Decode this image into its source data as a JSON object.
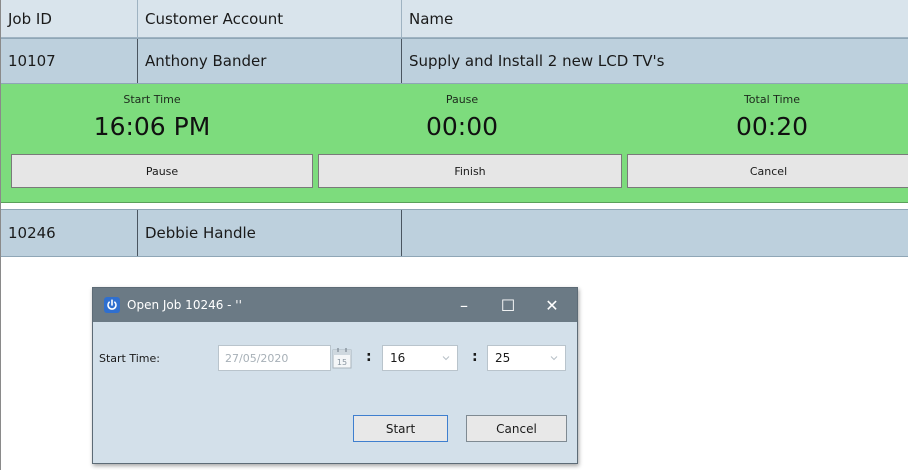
{
  "table": {
    "headers": [
      "Job ID",
      "Customer Account",
      "Name"
    ],
    "rows": [
      {
        "job_id": "10107",
        "customer": "Anthony Bander",
        "name": "Supply and Install 2 new LCD TV's"
      },
      {
        "job_id": "10246",
        "customer": "Debbie Handle",
        "name": ""
      }
    ]
  },
  "timer": {
    "start_label": "Start Time",
    "start_value": "16:06 PM",
    "pause_label": "Pause",
    "pause_value": "00:00",
    "total_label": "Total Time",
    "total_value": "00:20",
    "buttons": {
      "pause": "Pause",
      "finish": "Finish",
      "cancel": "Cancel"
    },
    "background_color": "#7ddc7d"
  },
  "dialog": {
    "title": "Open Job 10246 - ''",
    "start_time_label": "Start Time:",
    "date_value": "27/05/2020",
    "calendar_day": "15",
    "hour_value": "16",
    "minute_value": "25",
    "time_separator": ":",
    "minimize_glyph": "–",
    "maximize_glyph": "☐",
    "close_glyph": "✕",
    "start_button": "Start",
    "cancel_button": "Cancel"
  }
}
